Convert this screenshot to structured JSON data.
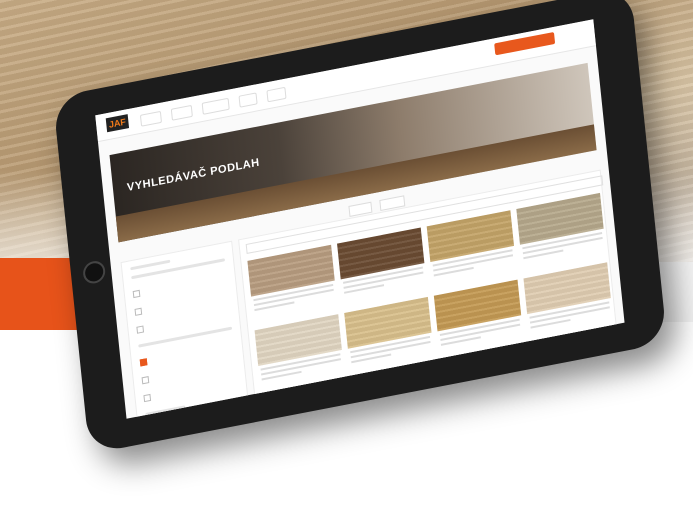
{
  "colors": {
    "accent": "#e8581d",
    "tablet_bezel": "#1c1c1c",
    "screen_bg": "#fafafa"
  },
  "site": {
    "logo": "JAF",
    "hero_title": "VYHLEDÁVAČ PODLAH"
  },
  "swatches": [
    "#b89d80",
    "#6b4c33",
    "#c4a468",
    "#b6a98c",
    "#e1d6c2",
    "#d9c08c",
    "#c49a54",
    "#e0cdb2"
  ],
  "icons": [
    "home-button-icon"
  ]
}
